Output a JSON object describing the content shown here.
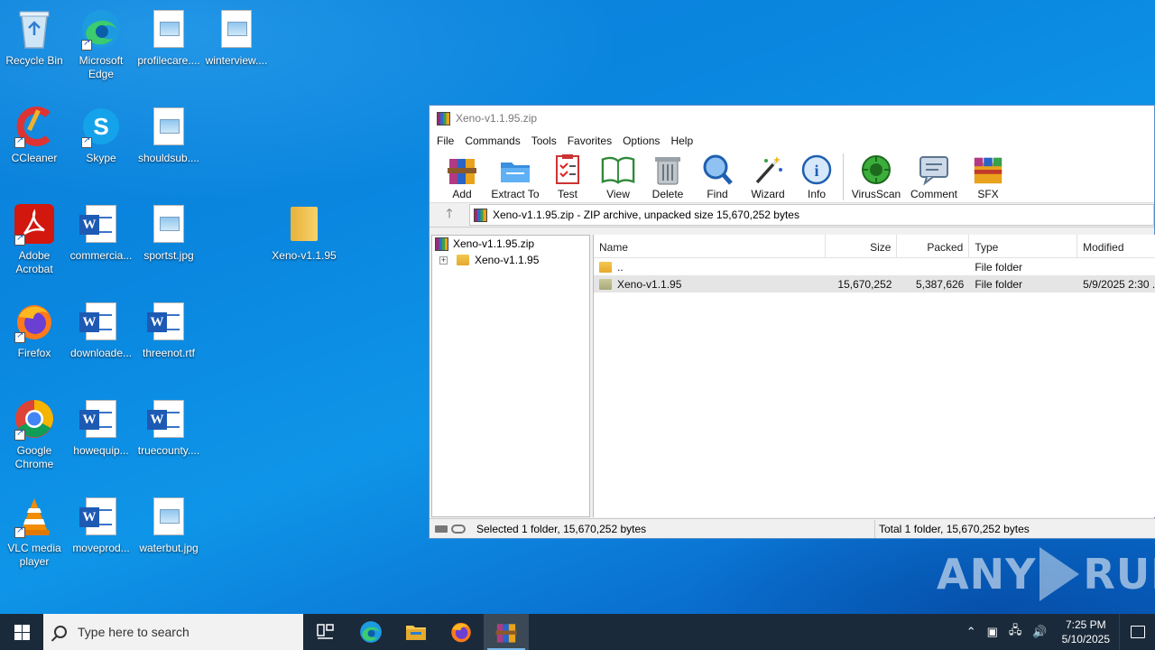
{
  "desktop": {
    "icons": [
      {
        "label": "Recycle Bin",
        "type": "recycle-bin"
      },
      {
        "label": "Microsoft Edge",
        "type": "edge"
      },
      {
        "label": "profilecare....",
        "type": "image"
      },
      {
        "label": "winterview....",
        "type": "image"
      },
      {
        "label": "CCleaner",
        "type": "ccleaner"
      },
      {
        "label": "Skype",
        "type": "skype"
      },
      {
        "label": "shouldsub....",
        "type": "image"
      },
      {
        "label": "Adobe Acrobat",
        "type": "acrobat"
      },
      {
        "label": "commercia...",
        "type": "word"
      },
      {
        "label": "sportst.jpg",
        "type": "image"
      },
      {
        "label": "Xeno-v1.1.95",
        "type": "folder"
      },
      {
        "label": "Firefox",
        "type": "firefox"
      },
      {
        "label": "downloade...",
        "type": "word"
      },
      {
        "label": "threenot.rtf",
        "type": "word"
      },
      {
        "label": "Google Chrome",
        "type": "chrome"
      },
      {
        "label": "howequip...",
        "type": "word"
      },
      {
        "label": "truecounty....",
        "type": "word"
      },
      {
        "label": "VLC media player",
        "type": "vlc"
      },
      {
        "label": "moveprod...",
        "type": "word"
      },
      {
        "label": "waterbut.jpg",
        "type": "image"
      }
    ]
  },
  "winrar": {
    "title": "Xeno-v1.1.95.zip",
    "menu": [
      "File",
      "Commands",
      "Tools",
      "Favorites",
      "Options",
      "Help"
    ],
    "toolbar": [
      "Add",
      "Extract To",
      "Test",
      "View",
      "Delete",
      "Find",
      "Wizard",
      "Info",
      "VirusScan",
      "Comment",
      "SFX"
    ],
    "address": "Xeno-v1.1.95.zip - ZIP archive, unpacked size 15,670,252 bytes",
    "tree": {
      "root": "Xeno-v1.1.95.zip",
      "child": "Xeno-v1.1.95"
    },
    "columns": {
      "name": "Name",
      "size": "Size",
      "packed": "Packed",
      "type": "Type",
      "modified": "Modified"
    },
    "rows": [
      {
        "name": "..",
        "size": "",
        "packed": "",
        "type": "File folder",
        "modified": ""
      },
      {
        "name": "Xeno-v1.1.95",
        "size": "15,670,252",
        "packed": "5,387,626",
        "type": "File folder",
        "modified": "5/9/2025 2:30 ..."
      }
    ],
    "status_left": "Selected 1 folder, 15,670,252 bytes",
    "status_right": "Total 1 folder, 15,670,252 bytes"
  },
  "watermark": {
    "left": "ANY",
    "right": "RUN"
  },
  "taskbar": {
    "search_placeholder": "Type here to search",
    "time": "7:25 PM",
    "date": "5/10/2025"
  }
}
